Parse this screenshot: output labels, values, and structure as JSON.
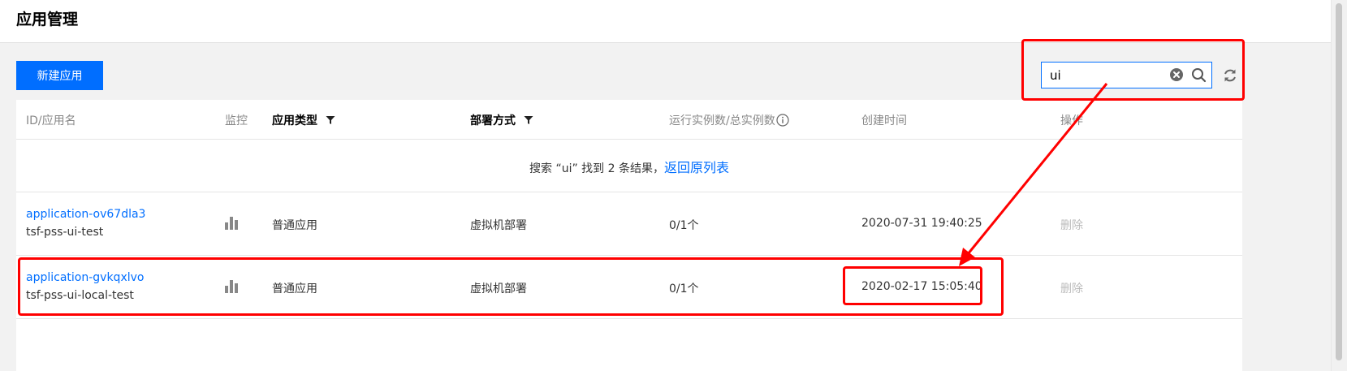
{
  "header": {
    "title": "应用管理"
  },
  "toolbar": {
    "create_label": "新建应用"
  },
  "search": {
    "value": "ui"
  },
  "table": {
    "columns": {
      "id_name": "ID/应用名",
      "monitor": "监控",
      "app_type": "应用类型",
      "deploy": "部署方式",
      "instances": "运行实例数/总实例数",
      "created": "创建时间",
      "actions": "操作"
    },
    "search_result": {
      "prefix": "搜索 “ui” 找到 2 条结果，",
      "back_label": "返回原列表"
    },
    "rows": [
      {
        "id": "application-ov67dla3",
        "name": "tsf-pss-ui-test",
        "type": "普通应用",
        "deploy": "虚拟机部署",
        "instances": "0/1个",
        "created": "2020-07-31 19:40:25",
        "action": "删除"
      },
      {
        "id": "application-gvkqxlvo",
        "name": "tsf-pss-ui-local-test",
        "type": "普通应用",
        "deploy": "虚拟机部署",
        "instances": "0/1个",
        "created": "2020-02-17 15:05:40",
        "action": "删除"
      }
    ]
  },
  "icons": {
    "clear": "clear-icon",
    "search": "search-icon",
    "refresh": "refresh-icon",
    "filter": "filter-icon",
    "info": "info-icon",
    "monitor": "bar-chart-icon"
  },
  "colors": {
    "primary": "#006eff",
    "annotation": "#ff0000",
    "page_bg": "#f2f2f2",
    "disabled_text": "#bbbbbb"
  }
}
